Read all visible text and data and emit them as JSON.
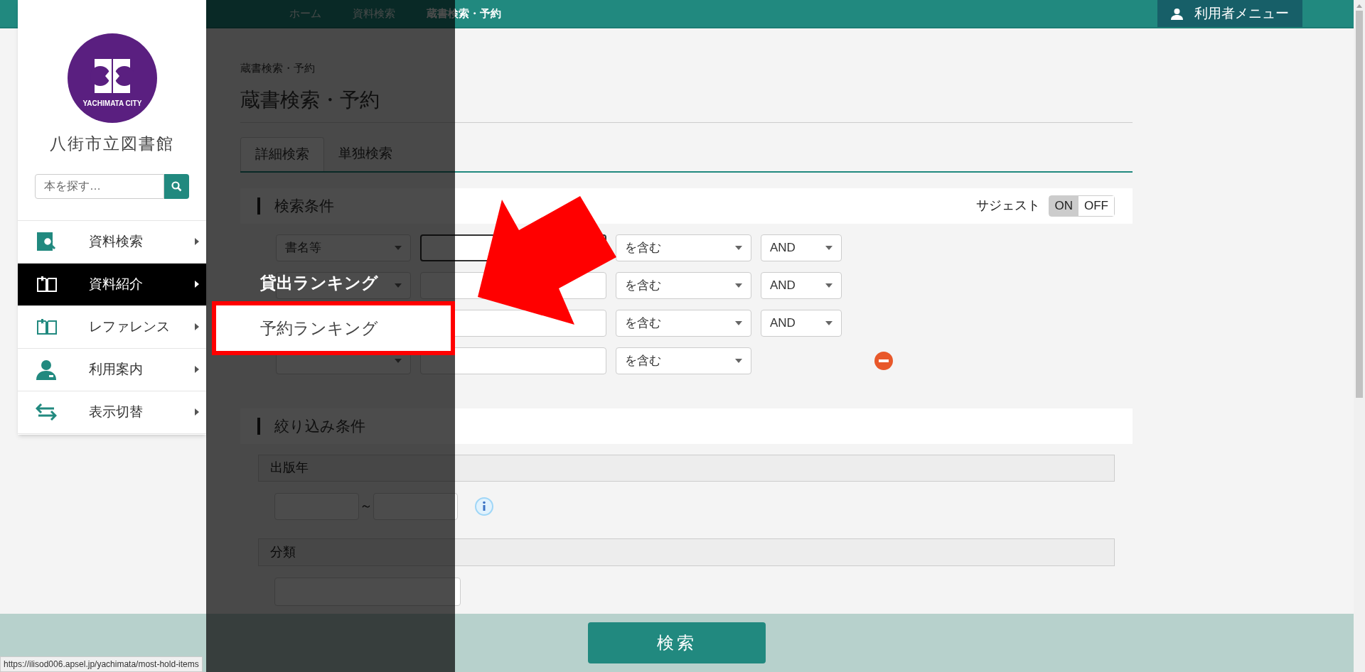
{
  "breadcrumb": [
    {
      "label": "ホーム"
    },
    {
      "label": "資料検索"
    },
    {
      "label": "蔵書検索・予約"
    }
  ],
  "user_menu": {
    "label": "利用者メニュー"
  },
  "sidebar": {
    "logo_text": "YACHIMATA CITY",
    "library_name": "八街市立図書館",
    "search": {
      "placeholder": "本を探す…"
    },
    "items": [
      {
        "kind": "search",
        "label": "資料検索",
        "selected": false
      },
      {
        "kind": "book",
        "label": "資料紹介",
        "selected": true
      },
      {
        "kind": "reference",
        "label": "レファレンス",
        "selected": false
      },
      {
        "kind": "person",
        "label": "利用案内",
        "selected": false
      },
      {
        "kind": "switch",
        "label": "表示切替",
        "selected": false
      }
    ]
  },
  "submenu": [
    {
      "label": "貸出ランキング",
      "selected": false
    },
    {
      "label": "予約ランキング",
      "selected": true
    }
  ],
  "page": {
    "small_title": "蔵書検索・予約",
    "title": "蔵書検索・予約",
    "tabs": [
      {
        "label": "詳細検索",
        "selected": true
      },
      {
        "label": "単独検索",
        "selected": false
      }
    ],
    "conditions": {
      "title": "検索条件",
      "suggest": {
        "label": "サジェスト",
        "options": [
          {
            "label": "ON",
            "selected": true
          },
          {
            "label": "OFF",
            "selected": false
          }
        ]
      },
      "rows": [
        {
          "field": "書名等",
          "field_shown": true,
          "focused": true,
          "match": "を含む",
          "operator": "AND"
        },
        {
          "field_shown": true,
          "match": "を含む",
          "operator": "AND",
          "focused": false
        },
        {
          "field_shown": false,
          "match": "を含む",
          "operator": "AND",
          "focused": false
        },
        {
          "field_shown": true,
          "match": "を含む",
          "focused": false,
          "removable": true
        }
      ]
    },
    "filters": {
      "title": "絞り込み条件",
      "year": {
        "label": "出版年",
        "separator": "～"
      },
      "classification": {
        "label": "分類"
      }
    }
  },
  "footer": {
    "search_button": "検索"
  },
  "status_url": "https://ilisod006.apsel.jp/yachimata/most-hold-items"
}
